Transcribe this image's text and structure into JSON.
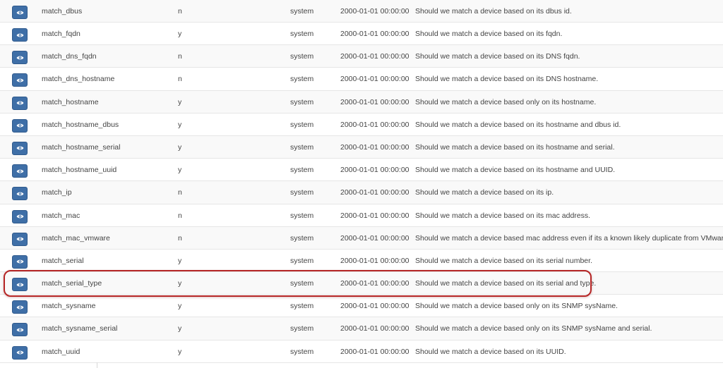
{
  "colors": {
    "button": "#3f6fa7",
    "highlight": "#b52525"
  },
  "icon": "eye-icon",
  "rows": [
    {
      "name": "match_dbus",
      "value": "n",
      "source": "system",
      "date": "2000-01-01 00:00:00",
      "description": "Should we match a device based on its dbus id."
    },
    {
      "name": "match_fqdn",
      "value": "y",
      "source": "system",
      "date": "2000-01-01 00:00:00",
      "description": "Should we match a device based on its fqdn."
    },
    {
      "name": "match_dns_fqdn",
      "value": "n",
      "source": "system",
      "date": "2000-01-01 00:00:00",
      "description": "Should we match a device based on its DNS fqdn."
    },
    {
      "name": "match_dns_hostname",
      "value": "n",
      "source": "system",
      "date": "2000-01-01 00:00:00",
      "description": "Should we match a device based on its DNS hostname."
    },
    {
      "name": "match_hostname",
      "value": "y",
      "source": "system",
      "date": "2000-01-01 00:00:00",
      "description": "Should we match a device based only on its hostname."
    },
    {
      "name": "match_hostname_dbus",
      "value": "y",
      "source": "system",
      "date": "2000-01-01 00:00:00",
      "description": "Should we match a device based on its hostname and dbus id."
    },
    {
      "name": "match_hostname_serial",
      "value": "y",
      "source": "system",
      "date": "2000-01-01 00:00:00",
      "description": "Should we match a device based on its hostname and serial."
    },
    {
      "name": "match_hostname_uuid",
      "value": "y",
      "source": "system",
      "date": "2000-01-01 00:00:00",
      "description": "Should we match a device based on its hostname and UUID."
    },
    {
      "name": "match_ip",
      "value": "n",
      "source": "system",
      "date": "2000-01-01 00:00:00",
      "description": "Should we match a device based on its ip."
    },
    {
      "name": "match_mac",
      "value": "n",
      "source": "system",
      "date": "2000-01-01 00:00:00",
      "description": "Should we match a device based on its mac address."
    },
    {
      "name": "match_mac_vmware",
      "value": "n",
      "source": "system",
      "date": "2000-01-01 00:00:00",
      "description": "Should we match a device based mac address even if its a known likely duplicate from VMware."
    },
    {
      "name": "match_serial",
      "value": "y",
      "source": "system",
      "date": "2000-01-01 00:00:00",
      "description": "Should we match a device based on its serial number."
    },
    {
      "name": "match_serial_type",
      "value": "y",
      "source": "system",
      "date": "2000-01-01 00:00:00",
      "description": "Should we match a device based on its serial and type."
    },
    {
      "name": "match_sysname",
      "value": "y",
      "source": "system",
      "date": "2000-01-01 00:00:00",
      "description": "Should we match a device based only on its SNMP sysName."
    },
    {
      "name": "match_sysname_serial",
      "value": "y",
      "source": "system",
      "date": "2000-01-01 00:00:00",
      "description": "Should we match a device based only on its SNMP sysName and serial."
    },
    {
      "name": "match_uuid",
      "value": "y",
      "source": "system",
      "date": "2000-01-01 00:00:00",
      "description": "Should we match a device based on its UUID."
    }
  ]
}
